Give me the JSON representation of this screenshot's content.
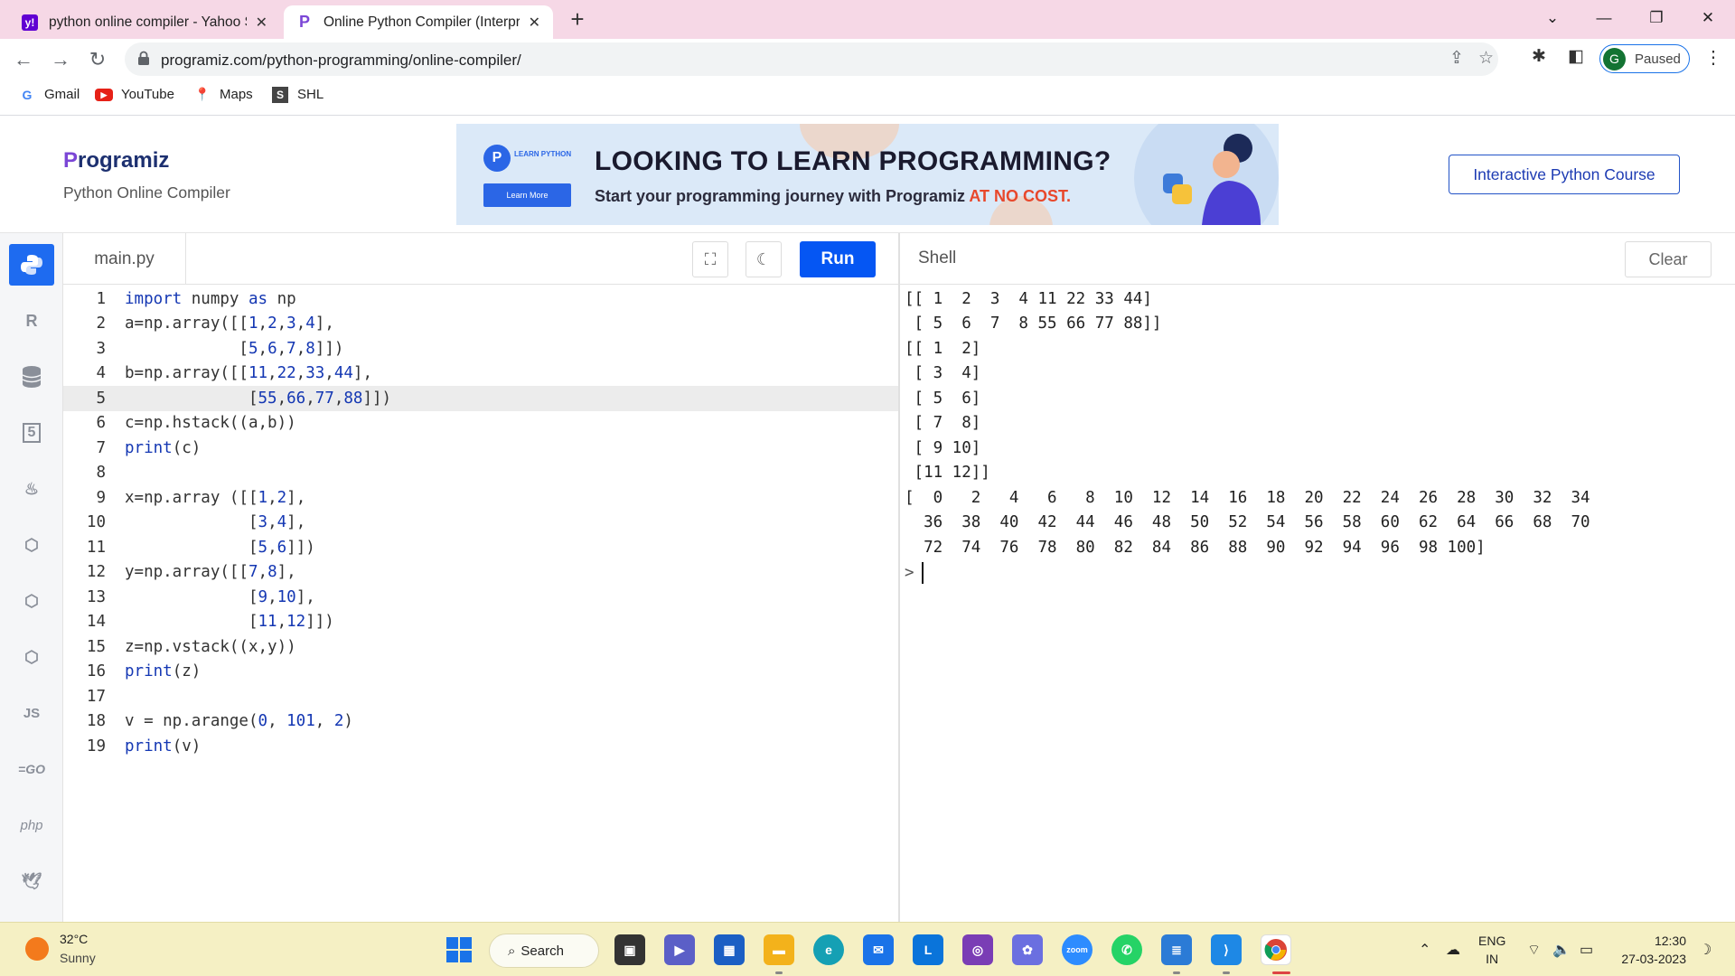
{
  "browser": {
    "tabs": [
      {
        "title": "python online compiler - Yahoo Search",
        "active": false
      },
      {
        "title": "Online Python Compiler (Interpreter)",
        "active": true
      }
    ],
    "url": "programiz.com/python-programming/online-compiler/",
    "profile_initial": "G",
    "profile_status": "Paused",
    "bookmarks": [
      "Gmail",
      "YouTube",
      "Maps",
      "SHL"
    ]
  },
  "header": {
    "logo": "rogramiz",
    "logo_mark": "P",
    "subtitle": "Python Online Compiler",
    "banner_badge": "LEARN PYTHON",
    "banner_button": "Learn More",
    "banner_headline": "LOOKING TO LEARN PROGRAMMING?",
    "banner_tag": "Start your programming journey with Programiz ",
    "banner_tag_highlight": "AT NO COST.",
    "course_button": "Interactive Python Course"
  },
  "sidebar": {
    "languages": [
      "Python",
      "R",
      "SQL",
      "HTML",
      "Java",
      "C",
      "C++",
      "C#",
      "JS",
      "GO",
      "php",
      "Swift"
    ]
  },
  "editor": {
    "file_name": "main.py",
    "run_label": "Run",
    "current_line": 5,
    "lines": [
      "import numpy as np",
      "a=np.array([[1,2,3,4],",
      "            [5,6,7,8]])",
      "b=np.array([[11,22,33,44],",
      "             [55,66,77,88]])",
      "c=np.hstack((a,b))",
      "print(c)",
      "",
      "x=np.array ([[1,2],",
      "             [3,4],",
      "             [5,6]])",
      "y=np.array([[7,8],",
      "             [9,10],",
      "             [11,12]])",
      "z=np.vstack((x,y))",
      "print(z)",
      "",
      "v = np.arange(0, 101, 2)",
      "print(v)"
    ]
  },
  "shell": {
    "title": "Shell",
    "clear_label": "Clear",
    "output": [
      "[[ 1  2  3  4 11 22 33 44]",
      " [ 5  6  7  8 55 66 77 88]]",
      "[[ 1  2]",
      " [ 3  4]",
      " [ 5  6]",
      " [ 7  8]",
      " [ 9 10]",
      " [11 12]]",
      "[  0   2   4   6   8  10  12  14  16  18  20  22  24  26  28  30  32  34",
      "  36  38  40  42  44  46  48  50  52  54  56  58  60  62  64  66  68  70",
      "  72  74  76  78  80  82  84  86  88  90  92  94  96  98 100]"
    ],
    "prompt": ">"
  },
  "taskbar": {
    "temperature": "32°C",
    "weather": "Sunny",
    "search_label": "Search",
    "lang_line1": "ENG",
    "lang_line2": "IN",
    "time": "12:30",
    "date": "27-03-2023"
  },
  "colors": {
    "run_button": "#0556f3",
    "active_language": "#1e6bf0",
    "tab_strip": "#f6d8e6",
    "taskbar": "#f5f0c4"
  }
}
